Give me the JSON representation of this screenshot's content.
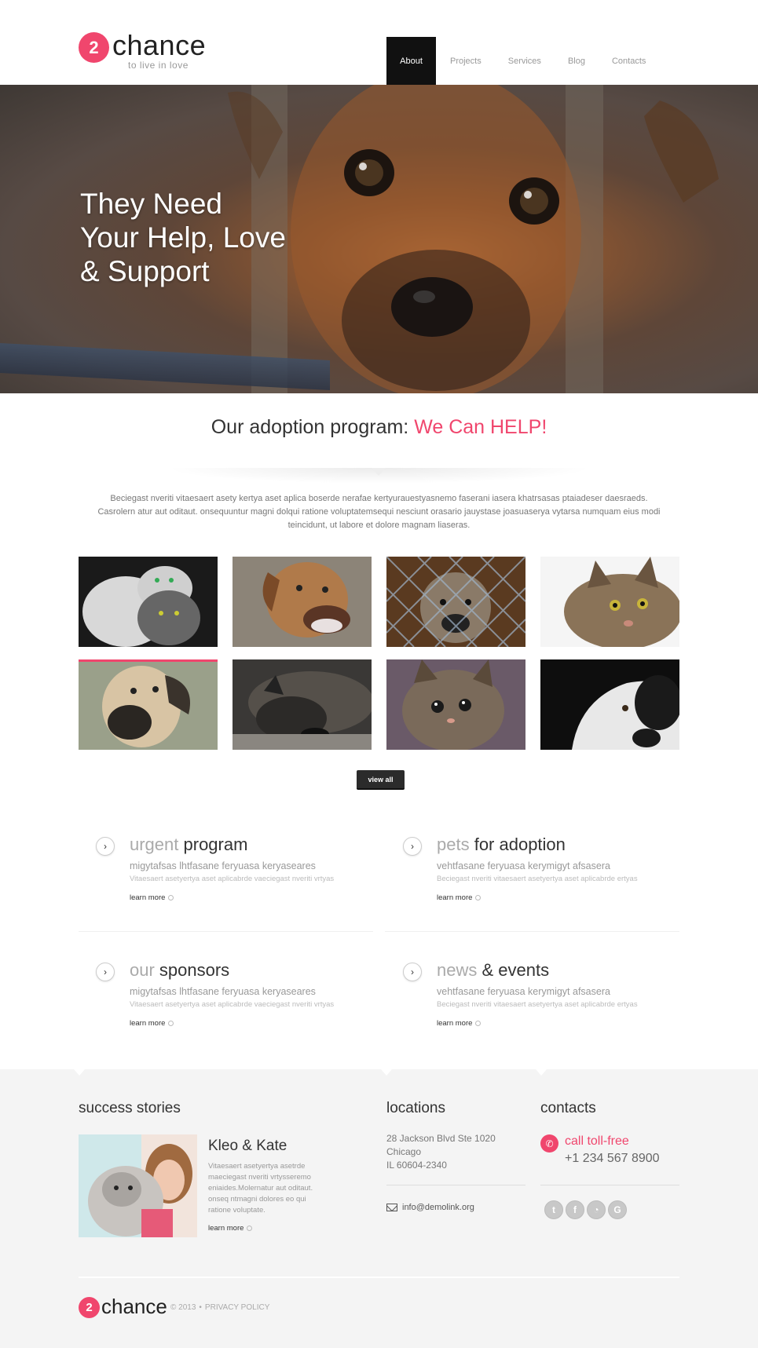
{
  "brand": {
    "logo_number": "2",
    "name": "chance",
    "tagline": "to live in love",
    "accent_color": "#f0466d"
  },
  "nav": {
    "items": [
      {
        "label": "About",
        "active": true
      },
      {
        "label": "Projects",
        "active": false
      },
      {
        "label": "Services",
        "active": false
      },
      {
        "label": "Blog",
        "active": false
      },
      {
        "label": "Contacts",
        "active": false
      }
    ]
  },
  "hero": {
    "line1": "They Need",
    "line2": "Your Help, Love",
    "line3": "& Support"
  },
  "adoption": {
    "title_prefix": "Our adoption program: ",
    "title_highlight": "We Can HELP!",
    "text": "Beciegast nveriti vitaesaert asety kertya aset aplica boserde nerafae kertyurauestyasnemo faserani  iasera khatrsasas ptaiadeser daesraeds. Casrolern atur aut oditaut. onsequuntur magni dolqui ratione voluptatemsequi nesciunt orasario jauystase joasuaserya vytarsa numquam eius modi teincidunt, ut labore et dolore magnam liaseras."
  },
  "gallery": {
    "images": [
      {
        "icon": "kittens-photo"
      },
      {
        "icon": "dog-photo"
      },
      {
        "icon": "dog-behind-fence-photo"
      },
      {
        "icon": "tabby-cat-photo"
      },
      {
        "icon": "mastiff-photo"
      },
      {
        "icon": "sleeping-dog-photo"
      },
      {
        "icon": "kitten-photo"
      },
      {
        "icon": "white-dog-photo"
      }
    ],
    "view_all_label": "view all"
  },
  "features": [
    {
      "light": "urgent",
      "dark": " program",
      "subtitle": "migytafsas lhtfasane feryuasa keryaseares",
      "desc": "Vitaesaert asetyertya aset aplicabrde vaeciegast nveriti vrtyas",
      "more": "learn more"
    },
    {
      "light": "pets",
      "dark": " for adoption",
      "subtitle": "vehtfasane feryuasa kerymigyt afsasera",
      "desc": "Beciegast nveriti vitaesaert asetyertya aset aplicabrde ertyas",
      "more": "learn more"
    },
    {
      "light": "our",
      "dark": " sponsors",
      "subtitle": "migytafsas lhtfasane feryuasa keryaseares",
      "desc": "Vitaesaert asetyertya aset aplicabrde vaeciegast nveriti vrtyas",
      "more": "learn more"
    },
    {
      "light": "news",
      "dark": " & events",
      "subtitle": "vehtfasane feryuasa kerymigyt afsasera",
      "desc": "Beciegast nveriti vitaesaert asetyertya aset aplicabrde ertyas",
      "more": "learn more"
    }
  ],
  "success": {
    "title": "success stories",
    "name": "Kleo & Kate",
    "text": "Vitaesaert asetyertya asetrde maeciegast nveriti vrtysseremo eniaides.Molernatur aut oditaut. onseq ntmagni dolores eo qui ratione voluptate.",
    "more": "learn more"
  },
  "locations": {
    "title": "locations",
    "address1": "28 Jackson Blvd Ste 1020",
    "address2": "Chicago",
    "address3": "IL 60604-2340",
    "email": "info@demolink.org"
  },
  "contacts": {
    "title": "contacts",
    "call_label": "call toll-free",
    "phone": "+1 234 567 8900",
    "socials": [
      {
        "icon": "twitter-icon",
        "glyph": "t"
      },
      {
        "icon": "facebook-icon",
        "glyph": "f"
      },
      {
        "icon": "rss-icon",
        "glyph": "◔"
      },
      {
        "icon": "google-icon",
        "glyph": "G"
      }
    ]
  },
  "footer": {
    "name": "chance",
    "year": "© 2013",
    "bullet": "•",
    "privacy": "PRIVACY POLICY"
  }
}
